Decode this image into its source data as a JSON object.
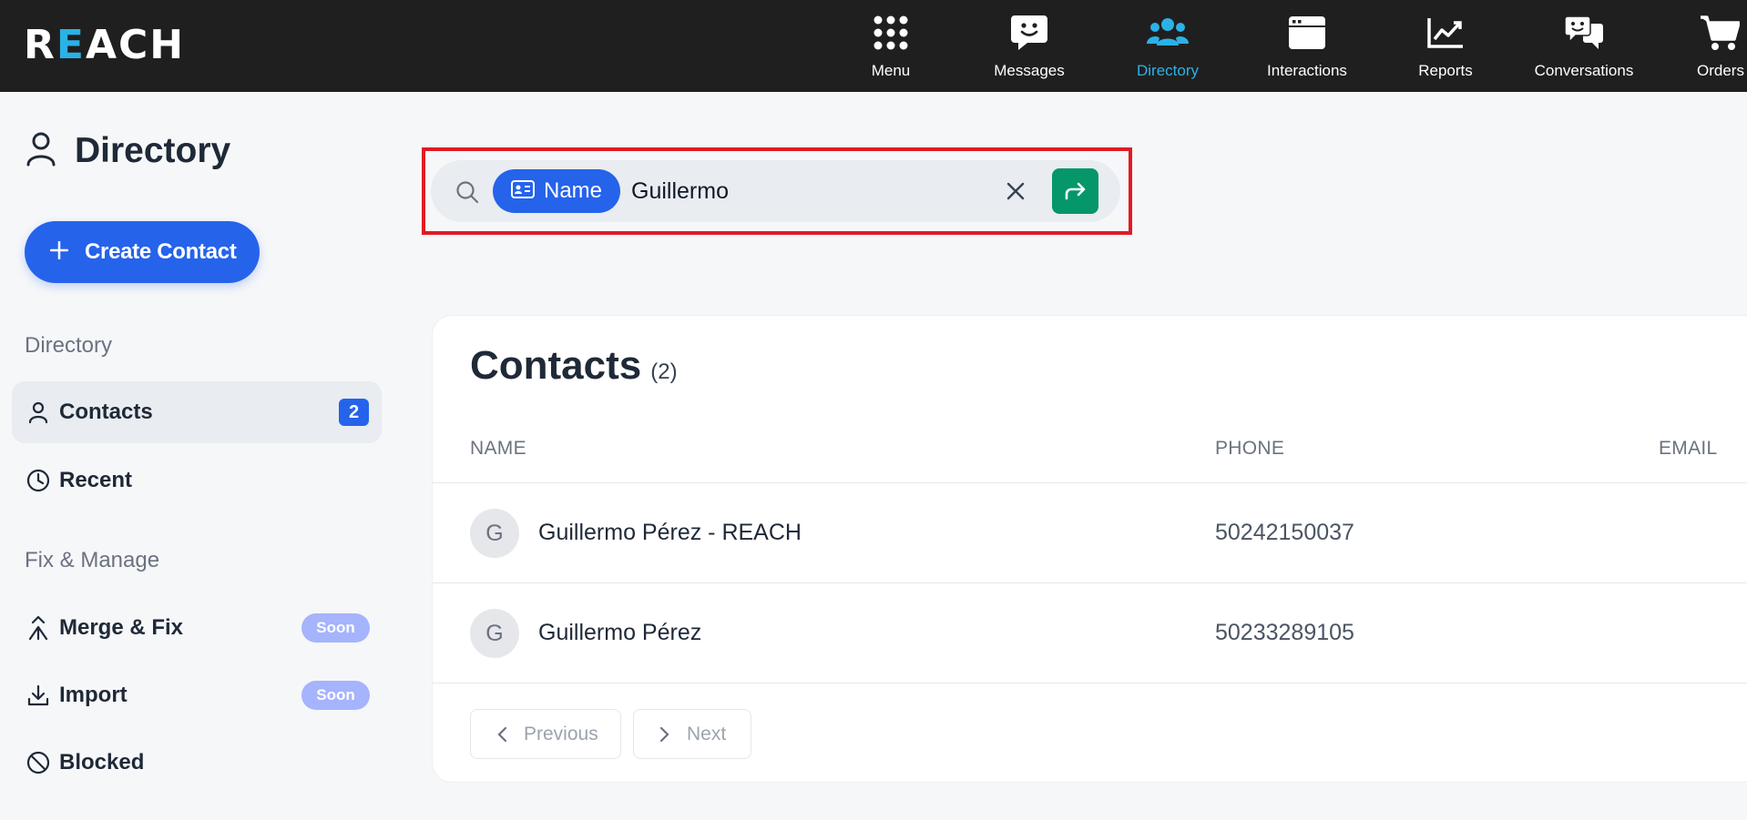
{
  "app": {
    "brand_prefix": "R",
    "brand_accent": "E",
    "brand_suffix": "ACH"
  },
  "nav": {
    "items": [
      {
        "label": "Menu",
        "icon": "grid-dots-icon"
      },
      {
        "label": "Messages",
        "icon": "smiley-chat-icon"
      },
      {
        "label": "Directory",
        "icon": "users-icon",
        "active": true
      },
      {
        "label": "Interactions",
        "icon": "window-icon"
      },
      {
        "label": "Reports",
        "icon": "chart-line-icon"
      },
      {
        "label": "Conversations",
        "icon": "conversations-icon"
      },
      {
        "label": "Orders",
        "icon": "cart-icon"
      }
    ]
  },
  "sidebar": {
    "title": "Directory",
    "create_label": "Create Contact",
    "section_directory": "Directory",
    "section_fix": "Fix & Manage",
    "items": [
      {
        "label": "Contacts",
        "badge": "2"
      },
      {
        "label": "Recent"
      },
      {
        "label": "Merge & Fix",
        "tag": "Soon"
      },
      {
        "label": "Import",
        "tag": "Soon"
      },
      {
        "label": "Blocked"
      }
    ]
  },
  "search": {
    "filter_label": "Name",
    "value": "Guillermo"
  },
  "contacts": {
    "title": "Contacts",
    "count": "(2)",
    "columns": {
      "name": "NAME",
      "phone": "PHONE",
      "email": "EMAIL"
    },
    "rows": [
      {
        "initial": "G",
        "name": "Guillermo Pérez - REACH",
        "phone": "50242150037"
      },
      {
        "initial": "G",
        "name": "Guillermo Pérez",
        "phone": "50233289105"
      }
    ],
    "previous_label": "Previous",
    "next_label": "Next"
  },
  "colors": {
    "accent": "#2563eb",
    "nav_active": "#2bb1e6",
    "go_button": "#059669",
    "highlight": "#e01b24"
  }
}
